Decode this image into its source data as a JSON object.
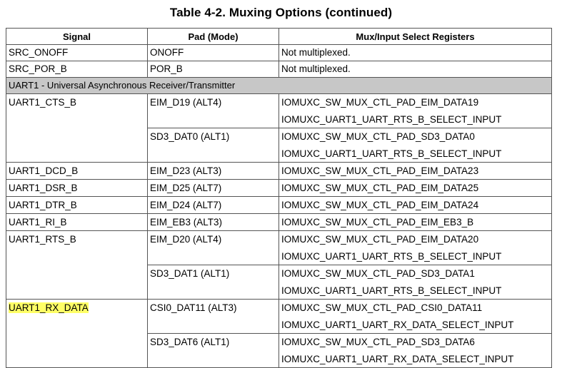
{
  "title": "Table 4-2.   Muxing Options (continued)",
  "headers": {
    "signal": "Signal",
    "pad": "Pad (Mode)",
    "registers": "Mux/Input Select Registers"
  },
  "rows": {
    "src_onoff": {
      "signal": "SRC_ONOFF",
      "pad": "ONOFF",
      "reg": "Not multiplexed."
    },
    "src_por_b": {
      "signal": "SRC_POR_B",
      "pad": "POR_B",
      "reg": "Not multiplexed."
    },
    "section": "UART1 - Universal Asynchronous Receiver/Transmitter",
    "cts": {
      "signal": "UART1_CTS_B",
      "pad1": "EIM_D19 (ALT4)",
      "reg1a": "IOMUXC_SW_MUX_CTL_PAD_EIM_DATA19",
      "reg1b": "IOMUXC_UART1_UART_RTS_B_SELECT_INPUT",
      "pad2": "SD3_DAT0 (ALT1)",
      "reg2a": "IOMUXC_SW_MUX_CTL_PAD_SD3_DATA0",
      "reg2b": "IOMUXC_UART1_UART_RTS_B_SELECT_INPUT"
    },
    "dcd": {
      "signal": "UART1_DCD_B",
      "pad": "EIM_D23 (ALT3)",
      "reg": "IOMUXC_SW_MUX_CTL_PAD_EIM_DATA23"
    },
    "dsr": {
      "signal": "UART1_DSR_B",
      "pad": "EIM_D25 (ALT7)",
      "reg": "IOMUXC_SW_MUX_CTL_PAD_EIM_DATA25"
    },
    "dtr": {
      "signal": "UART1_DTR_B",
      "pad": "EIM_D24 (ALT7)",
      "reg": "IOMUXC_SW_MUX_CTL_PAD_EIM_DATA24"
    },
    "ri": {
      "signal": "UART1_RI_B",
      "pad": "EIM_EB3 (ALT3)",
      "reg": "IOMUXC_SW_MUX_CTL_PAD_EIM_EB3_B"
    },
    "rts": {
      "signal": "UART1_RTS_B",
      "pad1": "EIM_D20 (ALT4)",
      "reg1a": "IOMUXC_SW_MUX_CTL_PAD_EIM_DATA20",
      "reg1b": "IOMUXC_UART1_UART_RTS_B_SELECT_INPUT",
      "pad2": "SD3_DAT1 (ALT1)",
      "reg2a": "IOMUXC_SW_MUX_CTL_PAD_SD3_DATA1",
      "reg2b": "IOMUXC_UART1_UART_RTS_B_SELECT_INPUT"
    },
    "rx": {
      "signal": "UART1_RX_DATA",
      "pad1": "CSI0_DAT11 (ALT3)",
      "reg1a": "IOMUXC_SW_MUX_CTL_PAD_CSI0_DATA11",
      "reg1b": "IOMUXC_UART1_UART_RX_DATA_SELECT_INPUT",
      "pad2": "SD3_DAT6 (ALT1)",
      "reg2a": "IOMUXC_SW_MUX_CTL_PAD_SD3_DATA6",
      "reg2b": "IOMUXC_UART1_UART_RX_DATA_SELECT_INPUT"
    }
  },
  "colors": {
    "highlight": "#ffff66",
    "section_bg": "#c7c7c7",
    "border": "#555555"
  }
}
